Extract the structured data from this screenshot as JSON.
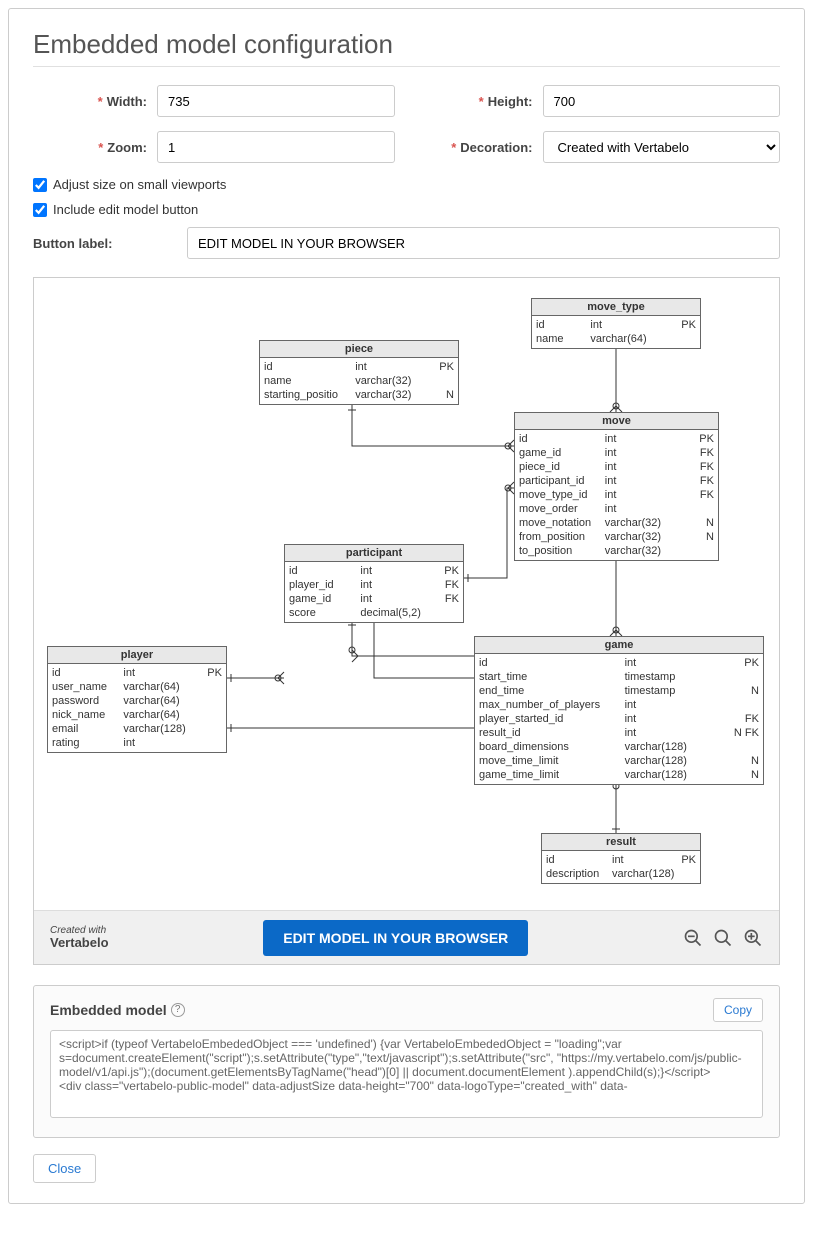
{
  "title": "Embedded model configuration",
  "form": {
    "width_label": "Width:",
    "width_value": "735",
    "height_label": "Height:",
    "height_value": "700",
    "zoom_label": "Zoom:",
    "zoom_value": "1",
    "decoration_label": "Decoration:",
    "decoration_value": "Created with Vertabelo",
    "adjust_label": "Adjust size on small viewports",
    "include_label": "Include edit model button",
    "button_label_label": "Button label:",
    "button_label_value": "EDIT MODEL IN YOUR BROWSER"
  },
  "footer": {
    "credit1": "Created with",
    "credit2": "Vertabelo",
    "edit_button": "EDIT MODEL IN YOUR BROWSER"
  },
  "embed": {
    "heading": "Embedded model",
    "copy": "Copy",
    "code": "<script>if (typeof VertabeloEmbededObject === 'undefined') {var VertabeloEmbededObject = \"loading\";var s=document.createElement(\"script\");s.setAttribute(\"type\",\"text/javascript\");s.setAttribute(\"src\", \"https://my.vertabelo.com/js/public-model/v1/api.js\");(document.getElementsByTagName(\"head\")[0] || document.documentElement ).appendChild(s);}</script>\n<div class=\"vertabelo-public-model\" data-adjustSize data-height=\"700\" data-logoType=\"created_with\" data-"
  },
  "close": "Close",
  "entities": {
    "player": {
      "title": "player",
      "rows": [
        {
          "n": "id",
          "t": "int",
          "k": "PK"
        },
        {
          "n": "user_name",
          "t": "varchar(64)",
          "k": ""
        },
        {
          "n": "password",
          "t": "varchar(64)",
          "k": ""
        },
        {
          "n": "nick_name",
          "t": "varchar(64)",
          "k": ""
        },
        {
          "n": "email",
          "t": "varchar(128)",
          "k": ""
        },
        {
          "n": "rating",
          "t": "int",
          "k": ""
        }
      ]
    },
    "piece": {
      "title": "piece",
      "rows": [
        {
          "n": "id",
          "t": "int",
          "k": "PK"
        },
        {
          "n": "name",
          "t": "varchar(32)",
          "k": ""
        },
        {
          "n": "starting_positio",
          "t": "varchar(32)",
          "k": "N"
        }
      ]
    },
    "move_type": {
      "title": "move_type",
      "rows": [
        {
          "n": "id",
          "t": "int",
          "k": "PK"
        },
        {
          "n": "name",
          "t": "varchar(64)",
          "k": ""
        }
      ]
    },
    "participant": {
      "title": "participant",
      "rows": [
        {
          "n": "id",
          "t": "int",
          "k": "PK"
        },
        {
          "n": "player_id",
          "t": "int",
          "k": "FK"
        },
        {
          "n": "game_id",
          "t": "int",
          "k": "FK"
        },
        {
          "n": "score",
          "t": "decimal(5,2)",
          "k": ""
        }
      ]
    },
    "move": {
      "title": "move",
      "rows": [
        {
          "n": "id",
          "t": "int",
          "k": "PK"
        },
        {
          "n": "game_id",
          "t": "int",
          "k": "FK"
        },
        {
          "n": "piece_id",
          "t": "int",
          "k": "FK"
        },
        {
          "n": "participant_id",
          "t": "int",
          "k": "FK"
        },
        {
          "n": "move_type_id",
          "t": "int",
          "k": "FK"
        },
        {
          "n": "move_order",
          "t": "int",
          "k": ""
        },
        {
          "n": "move_notation",
          "t": "varchar(32)",
          "k": "N"
        },
        {
          "n": "from_position",
          "t": "varchar(32)",
          "k": "N"
        },
        {
          "n": "to_position",
          "t": "varchar(32)",
          "k": ""
        }
      ]
    },
    "game": {
      "title": "game",
      "rows": [
        {
          "n": "id",
          "t": "int",
          "k": "PK"
        },
        {
          "n": "start_time",
          "t": "timestamp",
          "k": ""
        },
        {
          "n": "end_time",
          "t": "timestamp",
          "k": "N"
        },
        {
          "n": "max_number_of_players",
          "t": "int",
          "k": ""
        },
        {
          "n": "player_started_id",
          "t": "int",
          "k": "FK"
        },
        {
          "n": "result_id",
          "t": "int",
          "k": "N FK"
        },
        {
          "n": "board_dimensions",
          "t": "varchar(128)",
          "k": ""
        },
        {
          "n": "move_time_limit",
          "t": "varchar(128)",
          "k": "N"
        },
        {
          "n": "game_time_limit",
          "t": "varchar(128)",
          "k": "N"
        }
      ]
    },
    "result": {
      "title": "result",
      "rows": [
        {
          "n": "id",
          "t": "int",
          "k": "PK"
        },
        {
          "n": "description",
          "t": "varchar(128)",
          "k": ""
        }
      ]
    }
  }
}
